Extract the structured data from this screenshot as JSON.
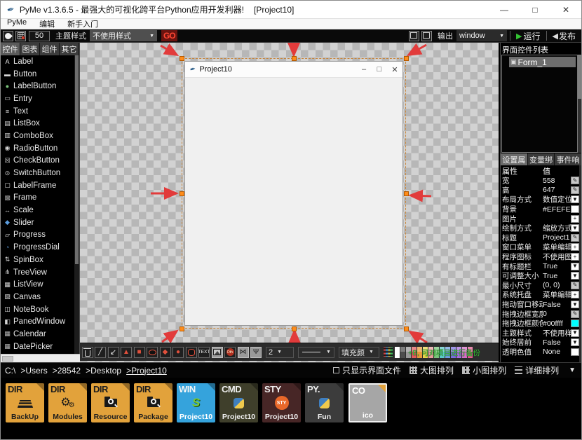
{
  "app": {
    "title": "PyMe v1.3.6.5 - 最强大的可视化跨平台Python应用开发利器!",
    "project": "[Project10]",
    "minimize": "—",
    "maximize": "□",
    "close": "✕"
  },
  "menubar": [
    "PyMe",
    "编辑",
    "新手入门"
  ],
  "toolbar": {
    "grid_size": "50",
    "theme_label": "主题样式",
    "style_value": "不使用样式",
    "go": "GO",
    "output": "输出",
    "window_value": "window",
    "run": "运行",
    "publish": "发布",
    "caret": "▼",
    "run_play": "▶",
    "publish_tri": "◀"
  },
  "widget_panel": {
    "tabs": [
      "控件",
      "图表",
      "组件",
      "其它"
    ],
    "active_tab": "控件",
    "items": [
      {
        "label": "Label",
        "glyph": "A",
        "color": "#e6e6e6"
      },
      {
        "label": "Button",
        "glyph": "▬",
        "color": "#d6d6d6"
      },
      {
        "label": "LabelButton",
        "glyph": "●",
        "color": "#7bc47b"
      },
      {
        "label": "Entry",
        "glyph": "▭",
        "color": "#d6d6d6"
      },
      {
        "label": "Text",
        "glyph": "≡",
        "color": "#d6d6d6"
      },
      {
        "label": "ListBox",
        "glyph": "▤",
        "color": "#d6d6d6"
      },
      {
        "label": "ComboBox",
        "glyph": "▥",
        "color": "#d6d6d6"
      },
      {
        "label": "RadioButton",
        "glyph": "◉",
        "color": "#d6d6d6"
      },
      {
        "label": "CheckButton",
        "glyph": "☒",
        "color": "#d6d6d6"
      },
      {
        "label": "SwitchButton",
        "glyph": "⊙",
        "color": "#d6d6d6"
      },
      {
        "label": "LabelFrame",
        "glyph": "▢",
        "color": "#d6d6d6"
      },
      {
        "label": "Frame",
        "glyph": "▩",
        "color": "#9a9a9a"
      },
      {
        "label": "Scale",
        "glyph": "↔",
        "color": "#d6d6d6"
      },
      {
        "label": "Slider",
        "glyph": "◆",
        "color": "#5c9ee0"
      },
      {
        "label": "Progress",
        "glyph": "▱",
        "color": "#d6d6d6"
      },
      {
        "label": "ProgressDial",
        "glyph": "◔",
        "color": "#5c9ee0"
      },
      {
        "label": "SpinBox",
        "glyph": "⇅",
        "color": "#d6d6d6"
      },
      {
        "label": "TreeView",
        "glyph": "⋔",
        "color": "#d6d6d6"
      },
      {
        "label": "ListView",
        "glyph": "▦",
        "color": "#d6d6d6"
      },
      {
        "label": "Canvas",
        "glyph": "▨",
        "color": "#d6d6d6"
      },
      {
        "label": "NoteBook",
        "glyph": "◫",
        "color": "#d6d6d6"
      },
      {
        "label": "PanedWindow",
        "glyph": "◧",
        "color": "#d6d6d6"
      },
      {
        "label": "Calendar",
        "glyph": "▦",
        "color": "#b8b8b8"
      },
      {
        "label": "DatePicker",
        "glyph": "▦",
        "color": "#b8b8b8"
      }
    ]
  },
  "design": {
    "window_title": "Project10",
    "minimize": "–",
    "maximize": "□",
    "close": "✕"
  },
  "draw_toolbar": {
    "tools": [
      "trash-icon",
      "line-icon",
      "arrow-southwest-icon",
      "triangle-icon",
      "rectangle-icon",
      "ellipse-icon",
      "diamond-icon",
      "circle-icon",
      "cylinder-icon",
      "text-tool-icon",
      "image-icon",
      "gis-icon",
      "flip-icon",
      "tree-shape-icon"
    ],
    "text_tool_label": "TEXT",
    "gis_label": "Dth",
    "line_width": "2",
    "fill_label": "填充颜",
    "hint": "+B, 可对项目进行备份",
    "palette": [
      "#ffffff",
      "#4d4d4d",
      "#999999",
      "#e05c5c",
      "#e8993c",
      "#e8d44d",
      "#e89d9d",
      "#7bc47b",
      "#5ccaca",
      "#6e9ee0",
      "#7b6ee0",
      "#a86ee0",
      "#d46ec4",
      "#e05c8f"
    ]
  },
  "right_panel": {
    "list_title": "界面控件列表",
    "form_item": "Form_1",
    "tabs": [
      "设置属",
      "变量绑",
      "事件响"
    ],
    "props_header": {
      "name": "属性",
      "value": "值"
    },
    "rows": [
      {
        "label": "宽",
        "value": "558",
        "glyph": "✎",
        "ctl_bg": "#c9c9c9",
        "ctl_fg": "#222222"
      },
      {
        "label": "高",
        "value": "647",
        "glyph": "✎",
        "ctl_bg": "#c9c9c9",
        "ctl_fg": "#222222"
      },
      {
        "label": "布局方式",
        "value": "数值定位",
        "glyph": "▼",
        "ctl_bg": "#ffffff",
        "ctl_fg": "#111111"
      },
      {
        "label": "背景",
        "value": "#EFEFEF",
        "glyph": "",
        "ctl_bg": "#ffffff",
        "ctl_fg": "#111111"
      },
      {
        "label": "图片",
        "value": "",
        "glyph": "+",
        "ctl_bg": "#ffffff",
        "ctl_fg": "#111111"
      },
      {
        "label": "绘制方式",
        "value": "缩放方式",
        "glyph": "▼",
        "ctl_bg": "#ffffff",
        "ctl_fg": "#111111"
      },
      {
        "label": "标题",
        "value": "Project1",
        "glyph": "✎",
        "ctl_bg": "#c9c9c9",
        "ctl_fg": "#222222"
      },
      {
        "label": "窗口菜单",
        "value": "菜单编辑",
        "glyph": "+",
        "ctl_bg": "#ffffff",
        "ctl_fg": "#111111"
      },
      {
        "label": "程序图标",
        "value": "不使用图",
        "glyph": "+",
        "ctl_bg": "#ffffff",
        "ctl_fg": "#111111"
      },
      {
        "label": "有标题栏",
        "value": "True",
        "glyph": "▼",
        "ctl_bg": "#ffffff",
        "ctl_fg": "#111111"
      },
      {
        "label": "可调整大小",
        "value": "True",
        "glyph": "▼",
        "ctl_bg": "#ffffff",
        "ctl_fg": "#111111"
      },
      {
        "label": "最小尺寸",
        "value": "(0, 0)",
        "glyph": "✎",
        "ctl_bg": "#c9c9c9",
        "ctl_fg": "#222222"
      },
      {
        "label": "系统托盘",
        "value": "菜单编辑",
        "glyph": "+",
        "ctl_bg": "#ffffff",
        "ctl_fg": "#111111"
      },
      {
        "label": "拖动窗口移动",
        "value": "False",
        "glyph": "▼",
        "ctl_bg": "#ffffff",
        "ctl_fg": "#111111"
      },
      {
        "label": "拖拽边框宽度",
        "value": "0",
        "glyph": "✎",
        "ctl_bg": "#c9c9c9",
        "ctl_fg": "#222222"
      },
      {
        "label": "拖拽边框颜色",
        "value": "#00ffff",
        "glyph": "",
        "ctl_bg": "#00ffff",
        "ctl_fg": "#111111"
      },
      {
        "label": "主题样式",
        "value": "不使用样",
        "glyph": "▼",
        "ctl_bg": "#ffffff",
        "ctl_fg": "#111111"
      },
      {
        "label": "始终居前",
        "value": "False",
        "glyph": "▼",
        "ctl_bg": "#ffffff",
        "ctl_fg": "#111111"
      },
      {
        "label": "透明色值",
        "value": "None",
        "glyph": "",
        "ctl_bg": "#ffffff",
        "ctl_fg": "#111111"
      }
    ]
  },
  "statusbar": {
    "path": [
      "C:\\",
      ">Users",
      ">28542",
      ">Desktop",
      ">Project10"
    ],
    "filter_label": "只显示界面文件",
    "view_large": "大图排列",
    "view_small": "小图排列",
    "view_detail": "详细排列",
    "caret": "▼"
  },
  "files": [
    {
      "badge": "DIR",
      "name": "BackUp",
      "icon": "layers-icon",
      "bg": "#e2a23b",
      "fg": "#1d1d1d",
      "badge_fg": "#1d1d1d"
    },
    {
      "badge": "DIR",
      "name": "Modules",
      "icon": "gears-icon",
      "bg": "#e2a23b",
      "fg": "#1d1d1d",
      "badge_fg": "#1d1d1d"
    },
    {
      "badge": "DIR",
      "name": "Resource",
      "icon": "folder-search-icon",
      "bg": "#e2a23b",
      "fg": "#1d1d1d",
      "badge_fg": "#1d1d1d"
    },
    {
      "badge": "DIR",
      "name": "Package",
      "icon": "folder-search-icon",
      "bg": "#e2a23b",
      "fg": "#1d1d1d",
      "badge_fg": "#1d1d1d"
    },
    {
      "badge": "WIN",
      "name": "Project10",
      "icon": "snake-icon",
      "bg": "#35a3dc",
      "fg": "#ffffff",
      "badge_fg": "#f5f5f5"
    },
    {
      "badge": "CMD",
      "name": "Project10",
      "icon": "python-logo-icon",
      "bg": "#3f3f2b",
      "fg": "#f0f0f0",
      "badge_fg": "#f0f0f0"
    },
    {
      "badge": "STY",
      "name": "Project10",
      "icon": "sty-circle-icon",
      "icon_text": "STY",
      "bg": "#472626",
      "fg": "#f0f0f0",
      "badge_fg": "#f0f0f0"
    },
    {
      "badge": "PY.",
      "name": "Fun",
      "icon": "python-logo-icon",
      "bg": "#3c3c3c",
      "fg": "#f0f0f0",
      "badge_fg": "#f0f0f0"
    },
    {
      "badge": "CO",
      "name": "ico",
      "icon": "image-placeholder-icon",
      "bg": "#a6a6a6",
      "fg": "#ffffff",
      "badge_fg": "#ffffff"
    }
  ]
}
